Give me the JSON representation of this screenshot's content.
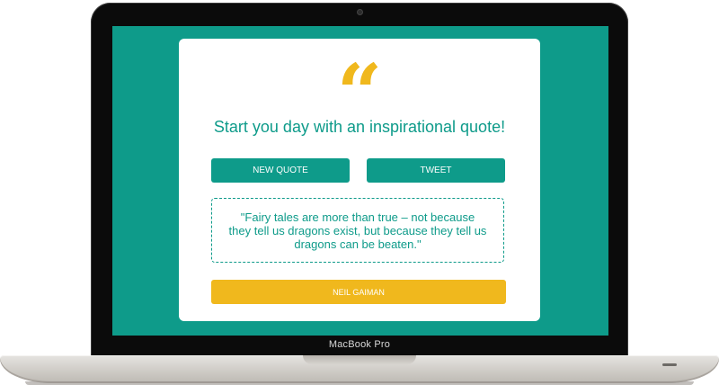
{
  "device": {
    "brand_label": "MacBook Pro"
  },
  "app": {
    "quote_mark": "“",
    "heading": "Start you day with an inspirational quote!",
    "buttons": {
      "new_quote": "NEW QUOTE",
      "tweet": "TWEET"
    },
    "quote": {
      "text": "\"Fairy tales are more than true – not because they tell us dragons exist, but because they tell us dragons can be beaten.\"",
      "author": "NEIL GAIMAN"
    }
  },
  "colors": {
    "accent": "#0e9b8a",
    "highlight": "#f0b81d",
    "card": "#ffffff"
  }
}
